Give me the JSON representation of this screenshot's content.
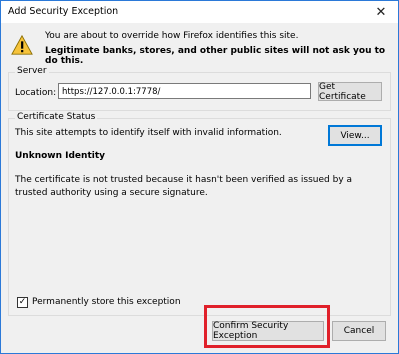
{
  "window": {
    "title": "Add Security Exception"
  },
  "icons": {
    "close": "close-icon",
    "warning": "warning-icon",
    "check": "checkmark-icon"
  },
  "messages": {
    "line1": "You are about to override how Firefox identifies this site.",
    "line2": "Legitimate banks, stores, and other public sites will not ask you to do this."
  },
  "server": {
    "legend": "Server",
    "location_label": "Location:",
    "location_value": "https://127.0.0.1:7778/",
    "get_certificate": "Get Certificate"
  },
  "status": {
    "legend": "Certificate Status",
    "info": "This site attempts to identify itself with invalid information.",
    "view_button": "View...",
    "heading": "Unknown Identity",
    "details": "The certificate is not trusted because it hasn't been verified as issued by a trusted authority using a secure signature."
  },
  "footer": {
    "store_label": "Permanently store this exception",
    "store_checked": true,
    "confirm_button": "Confirm Security Exception",
    "cancel_button": "Cancel"
  },
  "colors": {
    "accent": "#0078d7",
    "highlight": "#e0202a",
    "window_border": "#2b79d8"
  }
}
